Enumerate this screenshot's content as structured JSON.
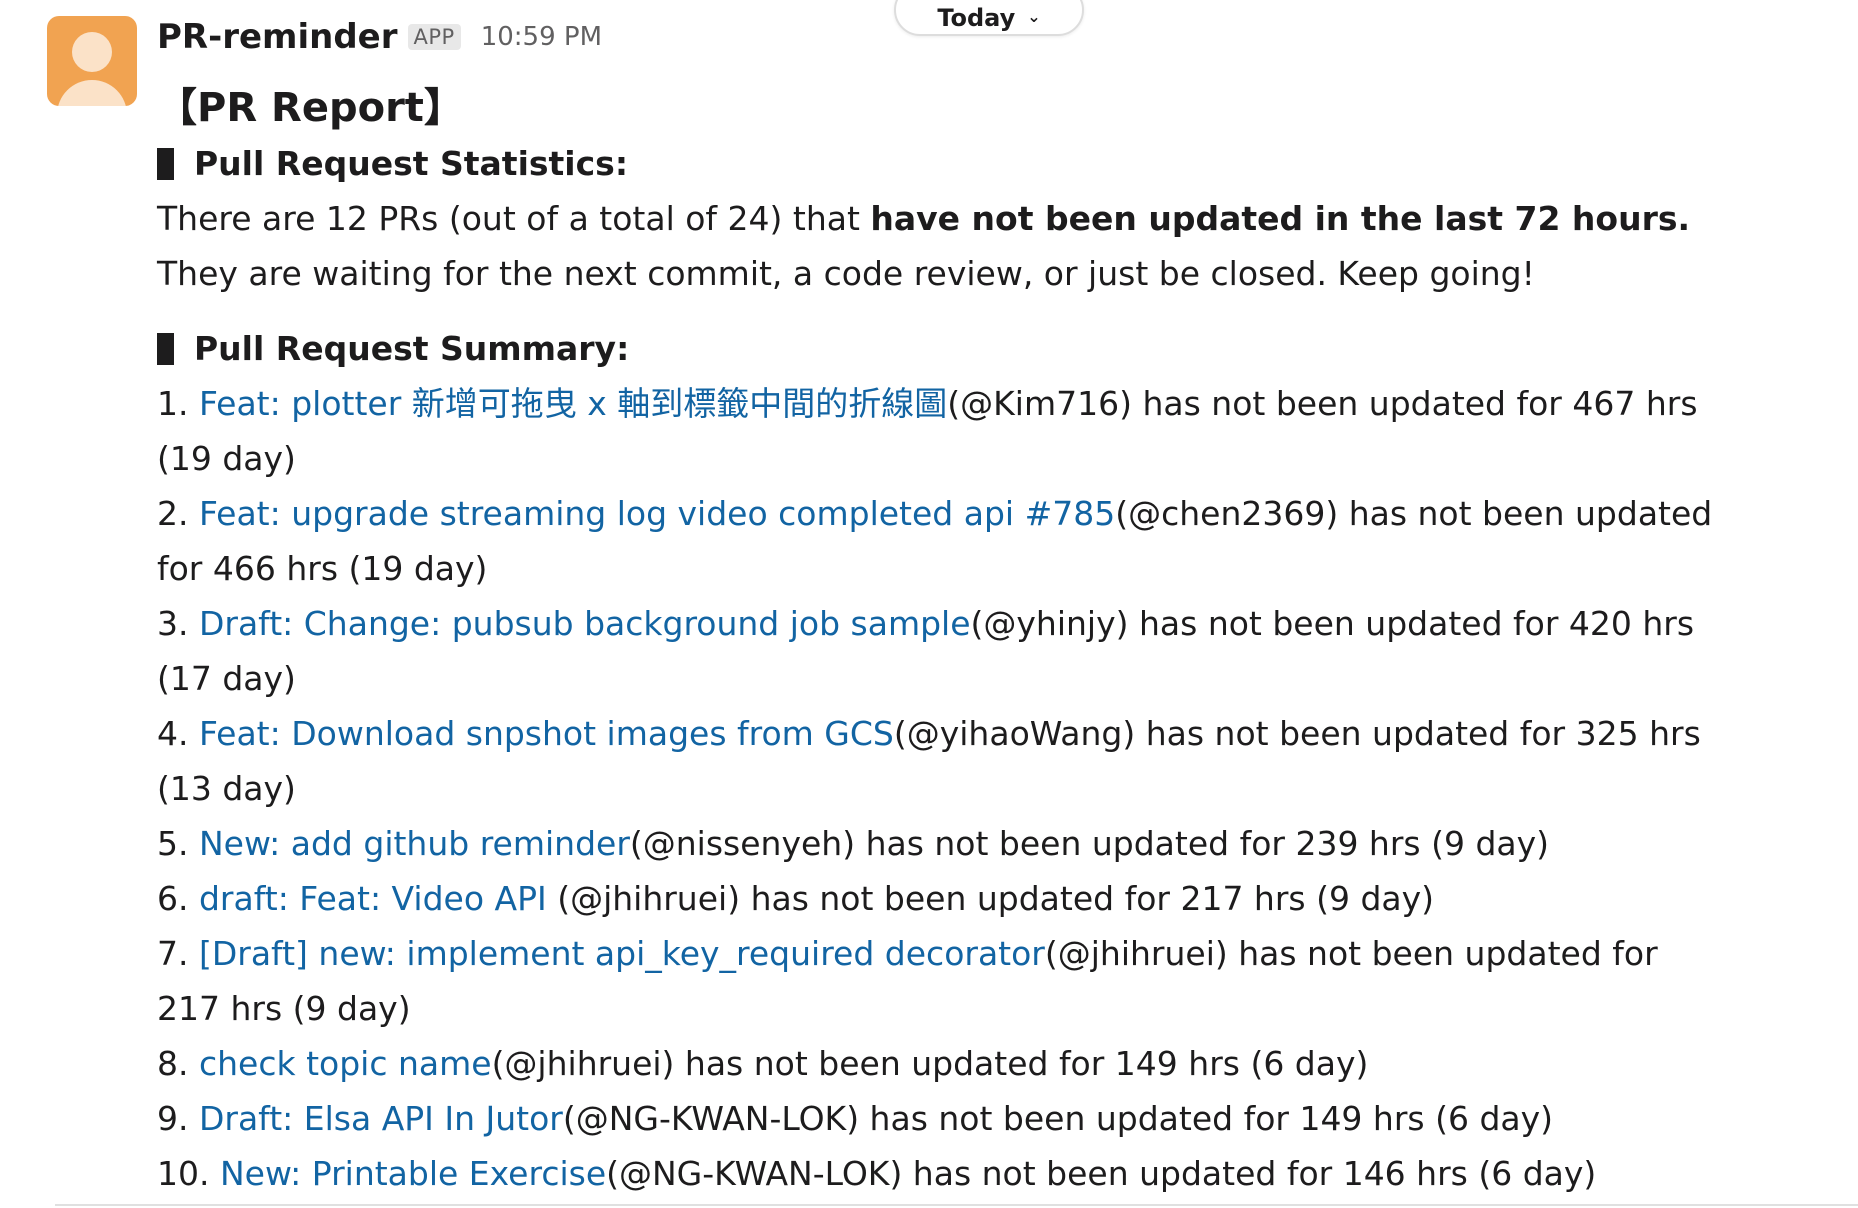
{
  "date_pill": {
    "label": "Today",
    "chevron": "⌄"
  },
  "message": {
    "sender": "PR-reminder",
    "app_badge": "APP",
    "time": "10:59 PM",
    "title": "【PR Report】",
    "stats": {
      "heading": "Pull Request Statistics:",
      "line1_prefix": "There are 12 PRs (out of a total of 24) that ",
      "line1_bold": "have not been updated in the last 72 hours.",
      "line2": "They are waiting for the next commit, a code review, or just be closed. Keep going!"
    },
    "summary": {
      "heading": "Pull Request Summary:",
      "items": [
        {
          "num": "1. ",
          "link": "Feat: plotter 新增可拖曳 x 軸到標籤中間的折線圖",
          "rest": "(@Kim716) has not been updated for 467 hrs (19 day)"
        },
        {
          "num": "2. ",
          "link": "Feat: upgrade streaming log video completed api #785",
          "rest": "(@chen2369) has not been updated for 466 hrs (19 day)"
        },
        {
          "num": "3. ",
          "link": "Draft: Change: pubsub background job sample",
          "rest": "(@yhinjy) has not been updated for 420 hrs (17 day)"
        },
        {
          "num": "4. ",
          "link": "Feat: Download snpshot images from GCS",
          "rest": "(@yihaoWang) has not been updated for 325 hrs (13 day)"
        },
        {
          "num": "5. ",
          "link": "New: add github reminder",
          "rest": "(@nissenyeh) has not been updated for 239 hrs (9 day)"
        },
        {
          "num": "6. ",
          "link": "draft: Feat: Video API ",
          "rest": "(@jhihruei) has not been updated for 217 hrs (9 day)"
        },
        {
          "num": "7. ",
          "link": "[Draft] new: implement api_key_required decorator",
          "rest": "(@jhihruei) has not been updated for 217 hrs (9 day)"
        },
        {
          "num": "8. ",
          "link": "check topic name",
          "rest": "(@jhihruei) has not been updated for 149 hrs (6 day)"
        },
        {
          "num": "9. ",
          "link": "Draft: Elsa API In Jutor",
          "rest": "(@NG-KWAN-LOK) has not been updated for 149 hrs (6 day)"
        },
        {
          "num": "10. ",
          "link": "New: Printable Exercise",
          "rest": "(@NG-KWAN-LOK) has not been updated for 146 hrs (6 day)"
        }
      ]
    }
  },
  "colors": {
    "link": "#1264a3",
    "text": "#1d1c1d",
    "muted": "#616061",
    "avatar_bg": "#f1a351"
  }
}
